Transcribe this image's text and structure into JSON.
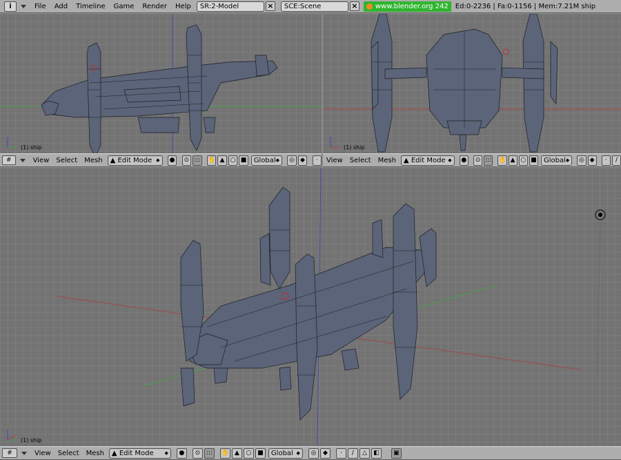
{
  "topbar": {
    "window_icon": "i",
    "menus": [
      "File",
      "Add",
      "Timeline",
      "Game",
      "Render",
      "Help"
    ],
    "screen": "SR:2-Model",
    "scene": "SCE:Scene",
    "link": "www.blender.org 242",
    "stats": "Ed:0-2236 | Fa:0-1156 | Mem:7.21M ship"
  },
  "viewports": {
    "top_left": {
      "label": "(1) ship"
    },
    "top_right": {
      "label": "(1) ship"
    },
    "bottom": {
      "label": "(1) ship"
    }
  },
  "header": {
    "menus": [
      "View",
      "Select",
      "Mesh"
    ],
    "mode": "Edit Mode",
    "orientation": "Global"
  },
  "colors": {
    "viewport_bg": "#737373",
    "grid_line": "#7c7c7c",
    "header_bg": "#aeaeae",
    "mesh_fill": "#5b6478",
    "mesh_edge": "#1a1d26",
    "axis_x": "#b04040",
    "axis_y": "#40a040",
    "axis_z": "#4040c0",
    "link_bg": "#2fb52f"
  }
}
